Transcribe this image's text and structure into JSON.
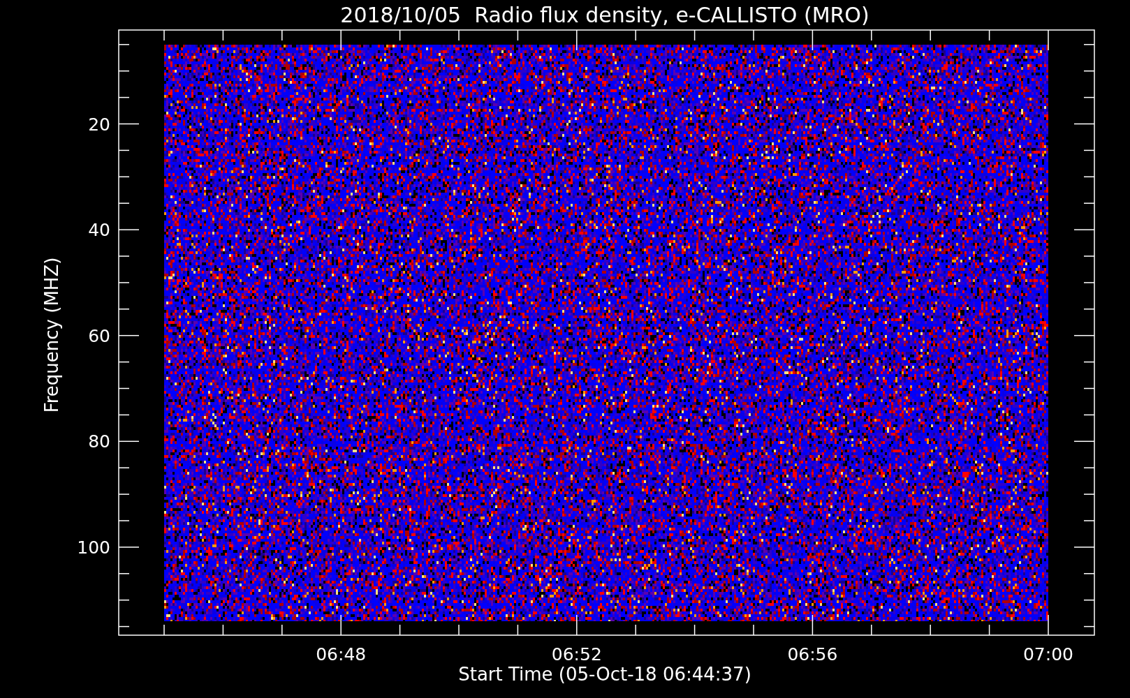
{
  "title": "2018/10/05  Radio flux density, e-CALLISTO (MRO)",
  "plot": {
    "ylabel": "Frequency (MHZ)",
    "yticks": [
      "20",
      "40",
      "60",
      "80",
      "100"
    ],
    "xlabel": "Start Time (05-Oct-18 06:44:37)",
    "xticks": [
      "06:48",
      "06:52",
      "06:56",
      "07:00"
    ]
  }
}
